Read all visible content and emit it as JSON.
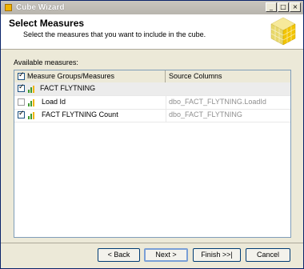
{
  "window": {
    "title": "Cube Wizard",
    "caption_buttons": [
      "_",
      "□",
      "×"
    ]
  },
  "header": {
    "title": "Select Measures",
    "subtitle": "Select the measures that you want to include in the cube."
  },
  "measures": {
    "label": "Available measures:",
    "columns": [
      "Measure Groups/Measures",
      "Source Columns"
    ],
    "header_checked": true,
    "rows": [
      {
        "type": "group",
        "label": "FACT FLYTNING",
        "source": "",
        "checked": true
      },
      {
        "type": "item",
        "label": "Load Id",
        "source": "dbo_FACT_FLYTNING.LoadId",
        "checked": false
      },
      {
        "type": "item",
        "label": "FACT FLYTNING Count",
        "source": "dbo_FACT_FLYTNING",
        "checked": true
      }
    ]
  },
  "buttons": {
    "back": "< Back",
    "next": "Next >",
    "finish": "Finish >>|",
    "cancel": "Cancel"
  },
  "colors": {
    "title_bar": "#b8b5ad",
    "header_bg": "#ffffff",
    "dialog_bg": "#ece9d8",
    "grid_border": "#7f9db9"
  }
}
